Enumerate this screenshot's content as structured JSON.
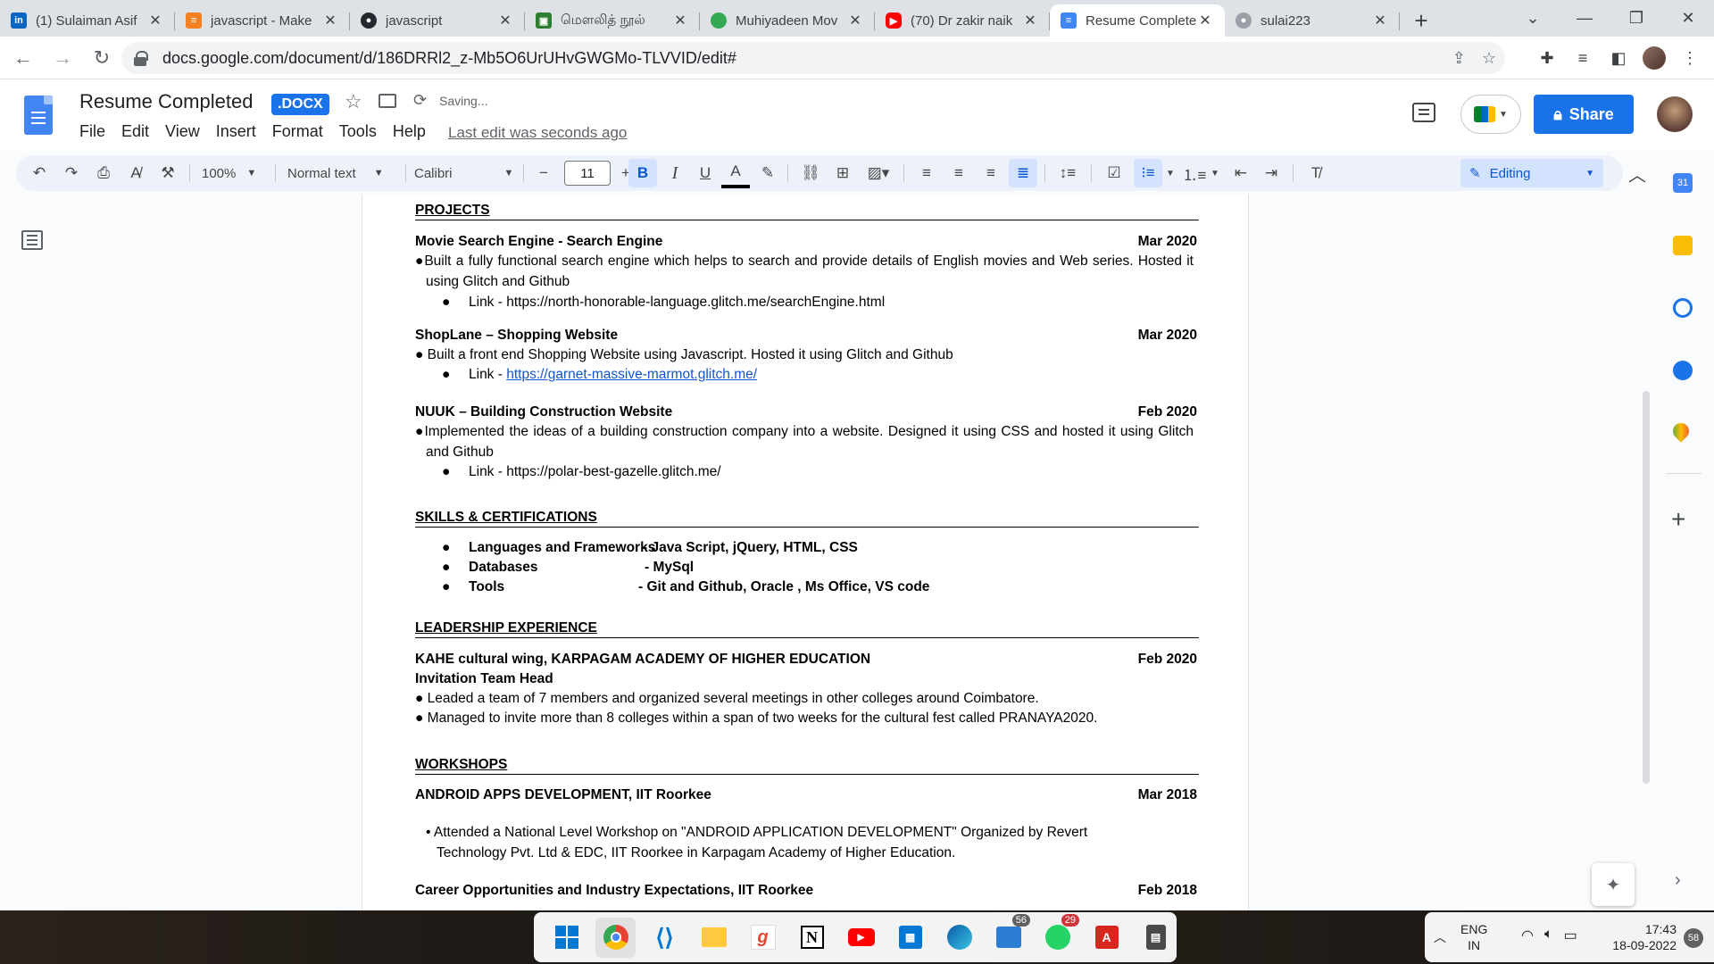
{
  "browser": {
    "tabs": [
      {
        "title": "(1) Sulaiman Asif",
        "favicon": "linkedin-icon",
        "color": "#0a66c2"
      },
      {
        "title": "javascript - Make",
        "favicon": "stackoverflow-icon",
        "color": "#f48024"
      },
      {
        "title": "javascript",
        "favicon": "github-icon",
        "color": "#24292f"
      },
      {
        "title": "மௌலித் நூல்",
        "favicon": "book-icon",
        "color": "#2e7d32"
      },
      {
        "title": "Muhiyadeen Mov",
        "favicon": "green-dot-icon",
        "color": "#34a853"
      },
      {
        "title": "(70) Dr zakir naik",
        "favicon": "youtube-icon",
        "color": "#ff0000"
      },
      {
        "title": "Resume Complete",
        "favicon": "docs-icon",
        "color": "#4285f4"
      },
      {
        "title": "sulai223",
        "favicon": "github-icon",
        "color": "#9aa0a6"
      }
    ],
    "url": "docs.google.com/document/d/186DRRl2_z-Mb5O6UrUHvGWGMo-TLVVID/edit#"
  },
  "doc": {
    "title": "Resume Completed",
    "badge": ".DOCX",
    "status": "Saving...",
    "last_edit": "Last edit was seconds ago",
    "menu": [
      "File",
      "Edit",
      "View",
      "Insert",
      "Format",
      "Tools",
      "Help"
    ],
    "share_label": "Share"
  },
  "toolbar": {
    "zoom": "100%",
    "style": "Normal text",
    "font": "Calibri",
    "font_size": "11",
    "mode": "Editing"
  },
  "content": {
    "projects": {
      "heading": "PROJECTS",
      "items": [
        {
          "title": "Movie Search Engine - Search Engine",
          "date": "Mar 2020",
          "desc": "●Built a fully functional search engine which helps to search and provide details of English movies and Web series. Hosted it using Glitch and Github",
          "link_prefix": "Link - ",
          "link": "https://north-honorable-language.glitch.me/searchEngine.html"
        },
        {
          "title": "ShopLane – Shopping Website",
          "date": "Mar 2020",
          "desc": "● Built a front end Shopping Website using Javascript. Hosted it using Glitch and Github",
          "link_prefix": "Link - ",
          "link": "https://garnet-massive-marmot.glitch.me/"
        },
        {
          "title": "NUUK – Building Construction Website",
          "date": "Feb 2020",
          "desc": "●Implemented the ideas of a building construction company into a website. Designed it using CSS and hosted it using Glitch and Github",
          "link_prefix": "Link - ",
          "link": "https://polar-best-gazelle.glitch.me/"
        }
      ]
    },
    "skills": {
      "heading": "SKILLS & CERTIFICATIONS",
      "items": [
        {
          "label": "Languages and Frameworks",
          "value": "- Java Script, jQuery, HTML, CSS"
        },
        {
          "label": "Databases",
          "value": "- MySql"
        },
        {
          "label": "Tools",
          "value": "- Git and Github, Oracle , Ms Office, VS code"
        }
      ]
    },
    "leadership": {
      "heading": "LEADERSHIP EXPERIENCE",
      "org": "KAHE cultural wing, KARPAGAM ACADEMY OF HIGHER EDUCATION",
      "date": "Feb 2020",
      "role": "Invitation Team Head",
      "points": [
        "● Leaded a team of 7 members and organized several meetings in other colleges around Coimbatore.",
        "● Managed to invite more than 8 colleges within a span of two weeks for the cultural fest called PRANAYA2020."
      ]
    },
    "workshops": {
      "heading": "WORKSHOPS",
      "items": [
        {
          "title": "ANDROID APPS DEVELOPMENT, IIT Roorkee",
          "date": "Mar 2018",
          "desc": "• Attended a National Level Workshop on \"ANDROID APPLICATION DEVELOPMENT\" Organized by Revert Technology Pvt. Ltd & EDC, IIT Roorkee in Karpagam Academy of Higher Education."
        },
        {
          "title": "Career Opportunities and Industry Expectations, IIT Roorkee",
          "date": "Feb 2018"
        }
      ]
    },
    "bullet": "●"
  },
  "taskbar": {
    "apps": [
      "start",
      "chrome",
      "vscode",
      "file-explorer",
      "grammarly",
      "notion",
      "youtube",
      "calendar",
      "edge",
      "teams",
      "whatsapp",
      "acrobat",
      "calculator"
    ],
    "badges": {
      "teams": "56",
      "whatsapp": "29"
    },
    "language": "ENG",
    "region": "IN",
    "time": "17:43",
    "date": "18-09-2022",
    "notifications": "58"
  }
}
